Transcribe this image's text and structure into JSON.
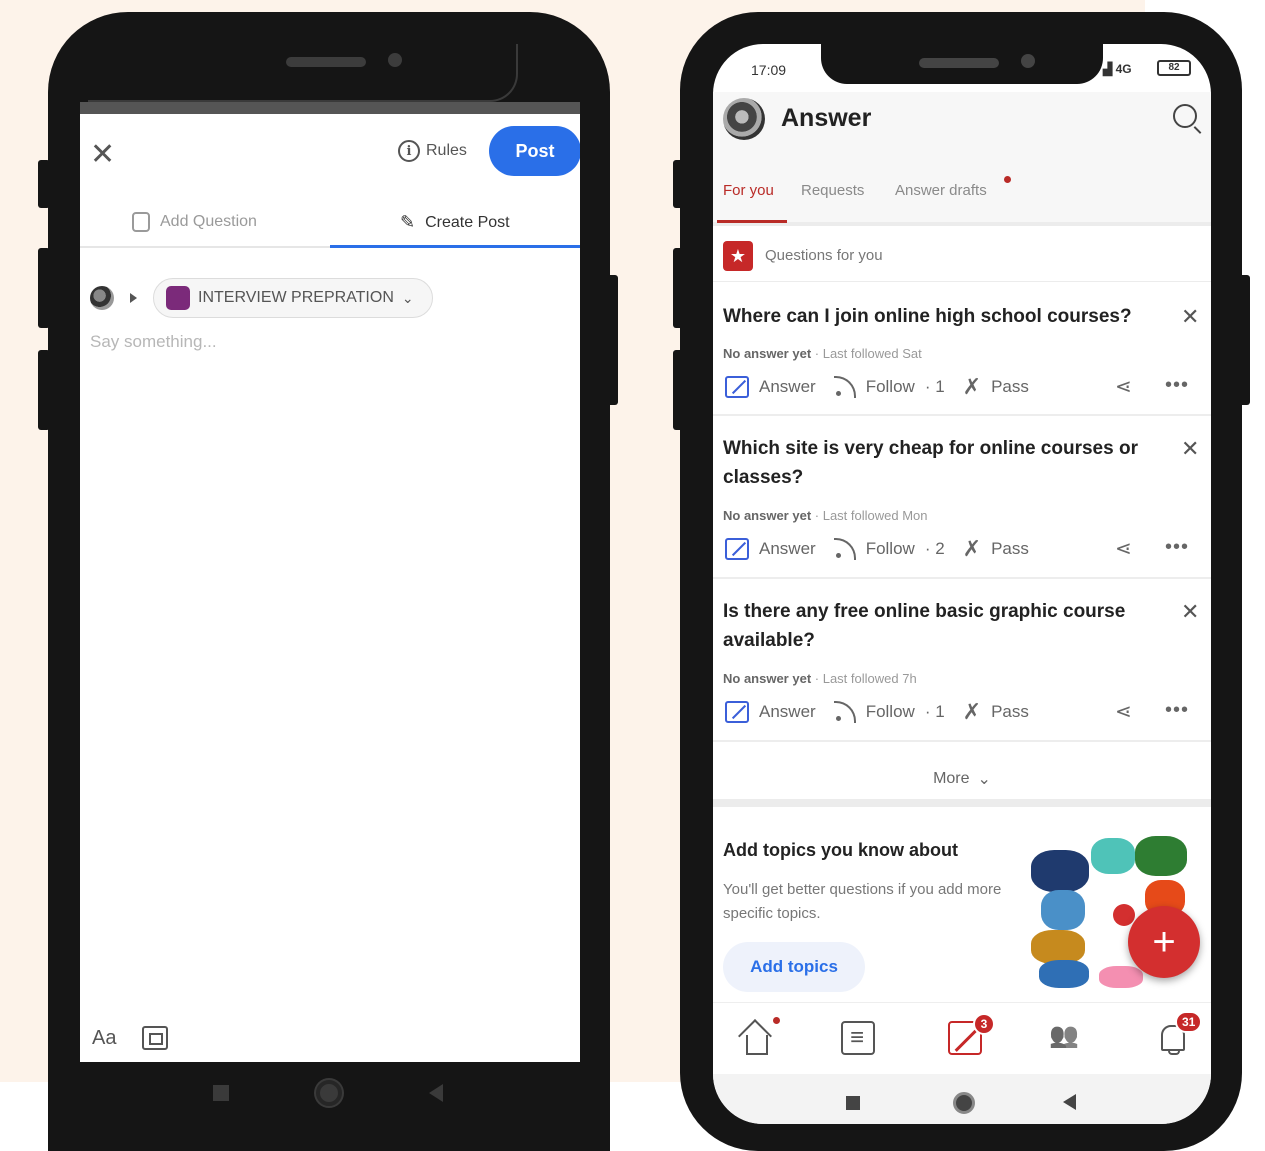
{
  "left_phone": {
    "rules_label": "Rules",
    "post_label": "Post",
    "tabs": [
      {
        "label": "Add Question"
      },
      {
        "label": "Create Post"
      }
    ],
    "space_name": "INTERVIEW PREPRATION",
    "placeholder": "Say something...",
    "format_label": "Aa"
  },
  "right_phone": {
    "status": {
      "time": "17:09",
      "network": "4G",
      "battery": "82"
    },
    "header_title": "Answer",
    "tabs": [
      {
        "label": "For you"
      },
      {
        "label": "Requests"
      },
      {
        "label": "Answer drafts"
      }
    ],
    "section_label": "Questions for you",
    "actions": {
      "answer": "Answer",
      "follow": "Follow",
      "pass": "Pass"
    },
    "questions": [
      {
        "title": "Where can I join online high school courses?",
        "status": "No answer yet",
        "followed": "· Last followed Sat",
        "follow_count": "· 1"
      },
      {
        "title": "Which site is very cheap for online courses or classes?",
        "status": "No answer yet",
        "followed": "· Last followed Mon",
        "follow_count": "· 2"
      },
      {
        "title": "Is there any free online basic graphic course available?",
        "status": "No answer yet",
        "followed": "· Last followed 7h",
        "follow_count": "· 1"
      }
    ],
    "more_label": "More",
    "topics": {
      "title": "Add topics you know about",
      "subtitle": "You'll get better questions if you add more specific topics.",
      "button": "Add topics"
    },
    "badges": {
      "answer": "3",
      "notifications": "31"
    }
  },
  "colors": {
    "accent_blue": "#2a6fe8",
    "brand_red": "#b92b27"
  }
}
